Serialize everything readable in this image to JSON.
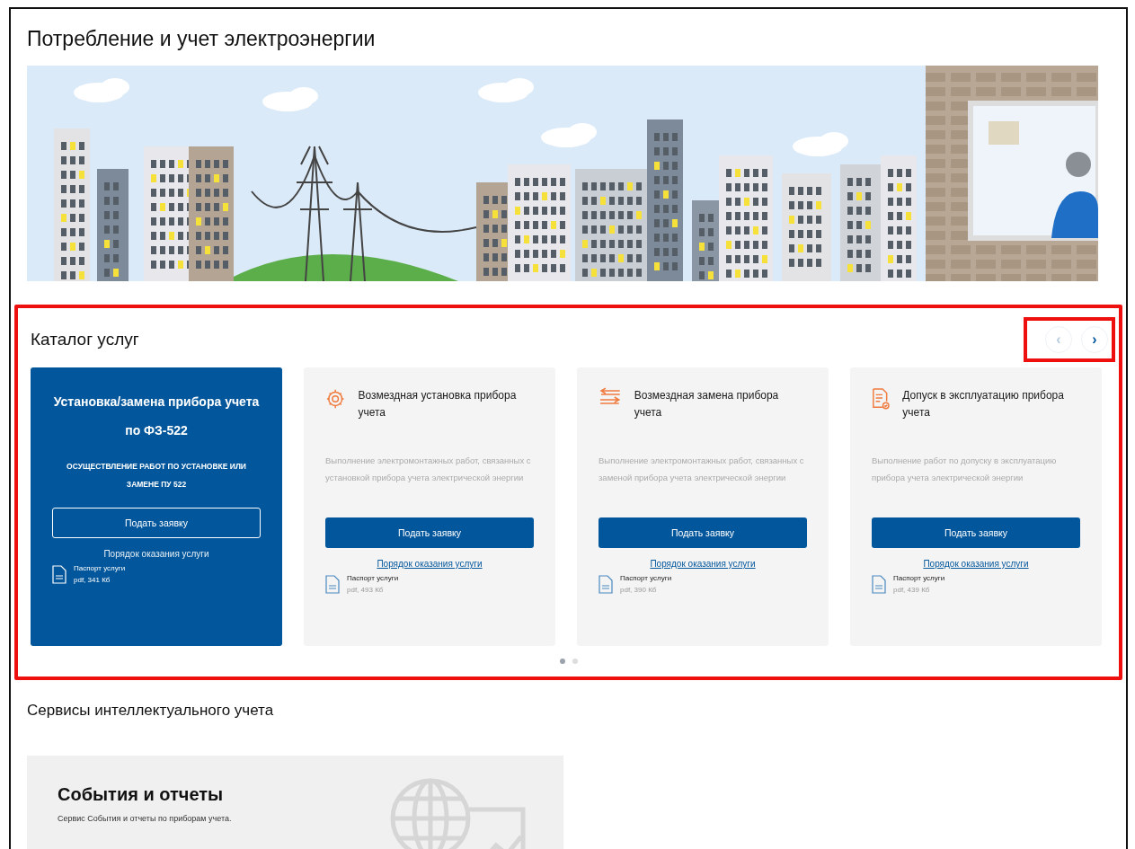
{
  "page": {
    "title": "Потребление и учет электроэнергии"
  },
  "catalog": {
    "title": "Каталог услуг",
    "highlighted": true,
    "nav": [
      {
        "label": "‹",
        "disabled": true
      },
      {
        "label": "›",
        "disabled": false
      }
    ],
    "cards": [
      {
        "kind": "featured",
        "title": "Установка/замена прибора учета по ФЗ-522",
        "description": "ОСУЩЕСТВЛЕНИЕ РАБОТ ПО УСТАНОВКЕ ИЛИ ЗАМЕНЕ ПУ 522",
        "button": "Подать заявку",
        "link": "Порядок оказания услуги",
        "file_name": "Паспорт услуги",
        "file_info": "pdf, 341 Кб"
      },
      {
        "kind": "regular",
        "title": "Возмездная установка прибора учета",
        "description": "Выполнение электромонтажных работ, связанных с установкой прибора учета электрической энергии",
        "button": "Подать заявку",
        "link": "Порядок оказания услуги",
        "file_name": "Паспорт услуги",
        "file_info": "pdf, 493 Кб"
      },
      {
        "kind": "regular",
        "title": "Возмездная замена прибора учета",
        "description": "Выполнение электромонтажных работ, связанных с заменой прибора учета электрической энергии",
        "button": "Подать заявку",
        "link": "Порядок оказания услуги",
        "file_name": "Паспорт услуги",
        "file_info": "pdf, 390 Кб"
      },
      {
        "kind": "regular",
        "title": "Допуск в эксплуатацию прибора учета",
        "description": "Выполнение работ по допуску в эксплуатацию прибора учета электрической энергии",
        "button": "Подать заявку",
        "link": "Порядок оказания услуги",
        "file_name": "Паспорт услуги",
        "file_info": "pdf, 439 Кб"
      }
    ],
    "dots": [
      {
        "selected": true
      },
      {
        "selected": false
      }
    ]
  },
  "services": {
    "title": "Сервисы интеллектуального учета",
    "cards": [
      {
        "title": "События и отчеты",
        "description": "Сервис События и отчеты по приборам учета."
      }
    ]
  }
}
